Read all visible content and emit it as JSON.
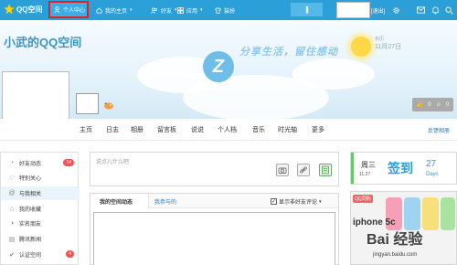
{
  "topbar": {
    "logo_text": "QQ空间",
    "items": [
      {
        "label": "个人中心"
      },
      {
        "label": "我的主页"
      },
      {
        "label": "好友"
      },
      {
        "label": "应用"
      },
      {
        "label": "装扮"
      }
    ],
    "pause_glyph": "||",
    "exit_label": "[退出]"
  },
  "header": {
    "page_title": "小武的QQ空间",
    "slogan": "分享生活，留住感动",
    "date_top": "农历",
    "date_main": "11月27日",
    "like_count": "0",
    "like_other": "0"
  },
  "tabs": [
    "主页",
    "日志",
    "相册",
    "留言板",
    "说说",
    "个人档",
    "音乐",
    "时光轴",
    "更多"
  ],
  "feedback_label": "反馈相册",
  "sidebar": {
    "items": [
      {
        "label": "好友动态",
        "badge": "14"
      },
      {
        "label": "特别关心"
      },
      {
        "label": "与我相关"
      },
      {
        "label": "我的收藏"
      },
      {
        "label": "实名朋友"
      },
      {
        "label": "腾讯新闻"
      },
      {
        "label": "认证空间",
        "badge": "4"
      }
    ]
  },
  "composer": {
    "placeholder": "说点儿什么吧"
  },
  "feed": {
    "tab_my": "我的空间动态",
    "tab_joined": "我参与的",
    "filter_label": "显示非好友评论",
    "filter_checked": "✓"
  },
  "sign": {
    "weekday": "周三",
    "date": "11.27",
    "button": "签到",
    "days_number": "27",
    "days_label": "Days"
  },
  "ad": {
    "badge": "QQ同购",
    "text": "iphone 5c"
  },
  "watermark": {
    "text": "Bai 经验",
    "url": "jingyan.baidu.com"
  },
  "colors": {
    "topbar": "#2a9fd8",
    "accent": "#2a7bc1",
    "badge_red": "#e55555",
    "sign_green": "#68c86b"
  }
}
